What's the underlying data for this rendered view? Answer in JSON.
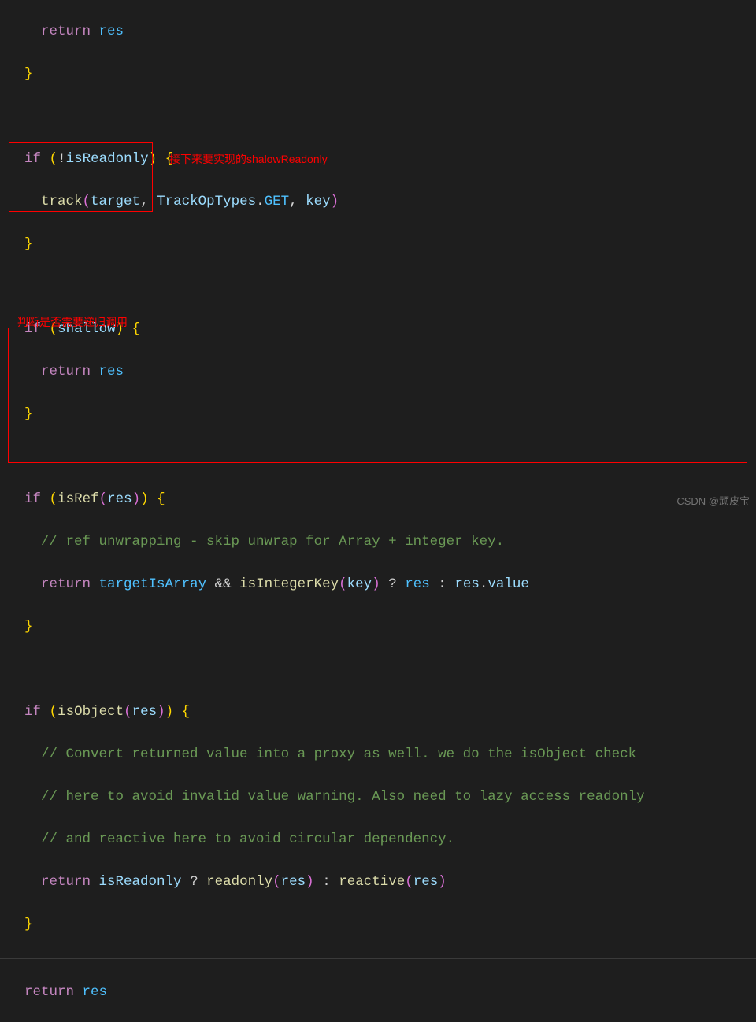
{
  "code": {
    "l1_return": "return",
    "l1_res": "res",
    "l2_brace": "}",
    "l4_if": "if",
    "l4_not": "!",
    "l4_isReadonly": "isReadonly",
    "l4_brace": "{",
    "l5_track": "track",
    "l5_target": "target",
    "l5_TrackOpTypes": "TrackOpTypes",
    "l5_GET": "GET",
    "l5_key": "key",
    "l6_brace": "}",
    "l8_if": "if",
    "l8_shallow": "shallow",
    "l8_brace": "{",
    "l9_return": "return",
    "l9_res": "res",
    "l10_brace": "}",
    "l12_if": "if",
    "l12_isRef": "isRef",
    "l12_res": "res",
    "l12_brace": "{",
    "l13_comment": "// ref unwrapping - skip unwrap for Array + integer key.",
    "l14_return": "return",
    "l14_targetIsArray": "targetIsArray",
    "l14_and": "&&",
    "l14_isIntegerKey": "isIntegerKey",
    "l14_key": "key",
    "l14_q": "?",
    "l14_res1": "res",
    "l14_colon": ":",
    "l14_res2": "res",
    "l14_value": "value",
    "l15_brace": "}",
    "l17_if": "if",
    "l17_isObject": "isObject",
    "l17_res": "res",
    "l17_brace": "{",
    "l18_comment": "// Convert returned value into a proxy as well. we do the isObject check",
    "l19_comment": "// here to avoid invalid value warning. Also need to lazy access readonly",
    "l20_comment": "// and reactive here to avoid circular dependency.",
    "l21_return": "return",
    "l21_isReadonly": "isReadonly",
    "l21_q": "?",
    "l21_readonly": "readonly",
    "l21_res1": "res",
    "l21_colon": ":",
    "l21_reactive": "reactive",
    "l21_res2": "res",
    "l22_brace": "}",
    "l24_return": "return",
    "l24_res": "res"
  },
  "annotations": {
    "a1": "接下来要实现的shalowReadonly",
    "a2": "判断是否需要递归调用"
  },
  "watermark": "CSDN @顽皮宝"
}
